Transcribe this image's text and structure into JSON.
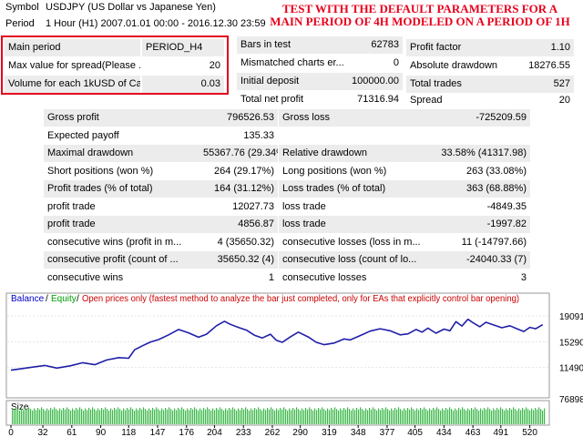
{
  "header": {
    "symbol_label": "Symbol",
    "symbol_value": "USDJPY (US Dollar vs Japanese Yen)",
    "period_label": "Period",
    "period_value": "1 Hour (H1) 2007.01.01 00:00 - 2016.12.30 23:59"
  },
  "annotation": {
    "line1": "TEST WITH THE DEFAULT PARAMETERS FOR A",
    "line2": "MAIN PERIOD OF 4H MODELED ON A PERIOD OF 1H"
  },
  "params": [
    {
      "label": "Main period",
      "value": "PERIOD_H4"
    },
    {
      "label": "Max value for spread(Please ...",
      "value": "20"
    },
    {
      "label": "Volume for each 1kUSD of Ca",
      "value": "0.03"
    }
  ],
  "mid_stats": [
    {
      "label": "Bars in test",
      "value": "62783"
    },
    {
      "label": "Mismatched charts er...",
      "value": "0"
    },
    {
      "label": "Initial deposit",
      "value": "100000.00"
    },
    {
      "label": "Total net profit",
      "value": "71316.94"
    }
  ],
  "right_stats": [
    {
      "label": "Profit factor",
      "value": "1.10"
    },
    {
      "label": "Absolute drawdown",
      "value": "18276.55"
    },
    {
      "label": "Total trades",
      "value": "527"
    },
    {
      "label": "Spread",
      "value": "20"
    }
  ],
  "left_table": [
    {
      "label": "Gross profit",
      "value": "796526.53"
    },
    {
      "label": "Expected payoff",
      "value": "135.33"
    },
    {
      "label": "Maximal drawdown",
      "value": "55367.76 (29.34%)"
    },
    {
      "label": "Short positions (won %)",
      "value": "264 (29.17%)"
    },
    {
      "label": "Profit trades (% of total)",
      "value": "164 (31.12%)"
    },
    {
      "label": "profit trade",
      "value": "12027.73"
    },
    {
      "label": "profit trade",
      "value": "4856.87"
    },
    {
      "label": "consecutive wins (profit in m...",
      "value": "4 (35650.32)"
    },
    {
      "label": "consecutive profit (count of ...",
      "value": "35650.32 (4)"
    },
    {
      "label": "consecutive wins",
      "value": "1"
    }
  ],
  "right_table": [
    {
      "label": "Gross loss",
      "value": "-725209.59"
    },
    {
      "label": "",
      "value": ""
    },
    {
      "label": "Relative drawdown",
      "value": "33.58% (41317.98)"
    },
    {
      "label": "Long positions (won %)",
      "value": "263 (33.08%)"
    },
    {
      "label": "Loss trades (% of total)",
      "value": "363 (68.88%)"
    },
    {
      "label": "loss trade",
      "value": "-4849.35"
    },
    {
      "label": "loss trade",
      "value": "-1997.82"
    },
    {
      "label": "consecutive losses (loss in m...",
      "value": "11 (-14797.66)"
    },
    {
      "label": "consecutive loss (count of lo...",
      "value": "-24040.33 (7)"
    },
    {
      "label": "consecutive losses",
      "value": "3"
    }
  ],
  "chart_data": {
    "type": "line",
    "legend": {
      "balance": "Balance",
      "equity": "Equity",
      "sep": "/",
      "text": "Open prices only (fastest method to analyze the bar just completed, only for EAs that explicitly control bar opening)"
    },
    "y_ticks": [
      "190912",
      "152908",
      "114903",
      "76898"
    ],
    "ylim": [
      76898,
      203000
    ],
    "xlim": [
      0,
      535
    ],
    "x_ticks": [
      "0",
      "32",
      "61",
      "90",
      "118",
      "147",
      "176",
      "204",
      "233",
      "262",
      "290",
      "319",
      "348",
      "377",
      "405",
      "434",
      "463",
      "491",
      "520"
    ],
    "x_tick_values": [
      0,
      32,
      61,
      90,
      118,
      147,
      176,
      204,
      233,
      262,
      290,
      319,
      348,
      377,
      405,
      434,
      463,
      491,
      520
    ],
    "size_label": "Size",
    "series": [
      {
        "name": "Balance",
        "points": [
          [
            0,
            111000
          ],
          [
            10,
            113000
          ],
          [
            22,
            115500
          ],
          [
            34,
            118000
          ],
          [
            46,
            114000
          ],
          [
            60,
            117500
          ],
          [
            72,
            122000
          ],
          [
            84,
            119000
          ],
          [
            96,
            126000
          ],
          [
            108,
            129500
          ],
          [
            118,
            128500
          ],
          [
            124,
            141000
          ],
          [
            132,
            147000
          ],
          [
            140,
            152500
          ],
          [
            148,
            156000
          ],
          [
            158,
            163000
          ],
          [
            168,
            171000
          ],
          [
            178,
            166000
          ],
          [
            188,
            159500
          ],
          [
            196,
            164000
          ],
          [
            206,
            176500
          ],
          [
            214,
            183000
          ],
          [
            220,
            178500
          ],
          [
            228,
            174000
          ],
          [
            236,
            170000
          ],
          [
            244,
            162500
          ],
          [
            252,
            158500
          ],
          [
            260,
            164000
          ],
          [
            266,
            155000
          ],
          [
            272,
            152000
          ],
          [
            280,
            160000
          ],
          [
            288,
            167000
          ],
          [
            298,
            160000
          ],
          [
            306,
            152000
          ],
          [
            314,
            148500
          ],
          [
            324,
            151000
          ],
          [
            334,
            157000
          ],
          [
            340,
            155500
          ],
          [
            350,
            162000
          ],
          [
            360,
            168500
          ],
          [
            370,
            172000
          ],
          [
            380,
            169000
          ],
          [
            390,
            163000
          ],
          [
            398,
            164500
          ],
          [
            406,
            171000
          ],
          [
            412,
            167000
          ],
          [
            418,
            173000
          ],
          [
            426,
            165500
          ],
          [
            434,
            171500
          ],
          [
            440,
            169000
          ],
          [
            446,
            182500
          ],
          [
            452,
            176000
          ],
          [
            458,
            186000
          ],
          [
            464,
            180000
          ],
          [
            470,
            175000
          ],
          [
            476,
            181500
          ],
          [
            484,
            177500
          ],
          [
            492,
            173500
          ],
          [
            500,
            176500
          ],
          [
            508,
            171500
          ],
          [
            514,
            168000
          ],
          [
            520,
            174000
          ],
          [
            526,
            172000
          ],
          [
            533,
            178000
          ]
        ]
      }
    ]
  }
}
